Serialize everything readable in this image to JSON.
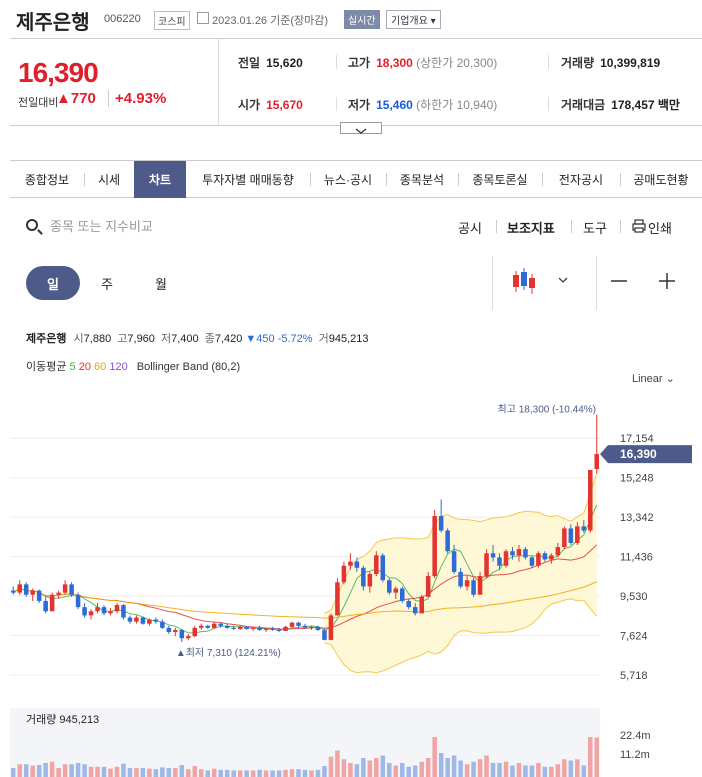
{
  "header": {
    "name": "제주은행",
    "code": "006220",
    "market": "코스피",
    "date": "2023.01.26 기준(장마감)",
    "realtime": "실시간",
    "corp_overview": "기업개요 ▾"
  },
  "price": {
    "current": "16,390",
    "prev_label": "전일대비",
    "change": "▲770",
    "change_pct": "+4.93%",
    "prev_close_label": "전일",
    "prev_close": "15,620",
    "open_label": "시가",
    "open": "15,670",
    "high_label": "고가",
    "high": "18,300",
    "upper_limit": "(상한가 20,300)",
    "low_label": "저가",
    "low": "15,460",
    "lower_limit": "(하한가 10,940)",
    "volume_label": "거래량",
    "volume": "10,399,819",
    "value_label": "거래대금",
    "value": "178,457 백만"
  },
  "tabs": [
    "종합정보",
    "시세",
    "차트",
    "투자자별 매매동향",
    "뉴스·공시",
    "종목분석",
    "종목토론실",
    "전자공시",
    "공매도현황"
  ],
  "active_tab": "차트",
  "search": {
    "placeholder": "종목 또는 지수비교"
  },
  "toolbar": {
    "disclosure": "공시",
    "indicators": "보조지표",
    "tools": "도구",
    "print": "인쇄"
  },
  "periods": [
    "일",
    "주",
    "월"
  ],
  "chart_header": {
    "name": "제주은행",
    "open_l": "시",
    "open": "7,880",
    "high_l": "고",
    "high": "7,960",
    "low_l": "저",
    "low": "7,400",
    "close_l": "종",
    "close": "7,420",
    "change": "▼450 -5.72%",
    "vol_l": "거",
    "vol": "945,213"
  },
  "ma_line": {
    "label": "이동평균",
    "p5": "5",
    "p20": "20",
    "p60": "60",
    "p120": "120",
    "bb": "Bollinger Band (80,2)"
  },
  "scale": "Linear",
  "colors": {
    "up": "#e3342f",
    "down": "#2e6bd6",
    "accent": "#4e5b8a"
  },
  "chart_data": {
    "type": "candlestick",
    "y_ticks": [
      "17,154",
      "15,248",
      "13,342",
      "11,436",
      "9,530",
      "7,624",
      "5,718"
    ],
    "ylim": [
      5000,
      19000
    ],
    "current_label": "16,390",
    "max_label": "최고 18,300 (-10.44%)",
    "min_label": "▲최저 7,310 (124.21%)",
    "candles": [
      [
        9800,
        10000,
        9600,
        9700
      ],
      [
        9700,
        10300,
        9600,
        10100
      ],
      [
        10100,
        10200,
        9500,
        9600
      ],
      [
        9600,
        9900,
        9300,
        9800
      ],
      [
        9800,
        9850,
        9200,
        9300
      ],
      [
        9300,
        9500,
        8700,
        8800
      ],
      [
        8800,
        9700,
        8800,
        9600
      ],
      [
        9600,
        9800,
        9400,
        9700
      ],
      [
        9700,
        10300,
        9600,
        10100
      ],
      [
        10100,
        10200,
        9500,
        9600
      ],
      [
        9600,
        9700,
        8900,
        9000
      ],
      [
        9000,
        9200,
        8500,
        8600
      ],
      [
        8600,
        8900,
        8400,
        8800
      ],
      [
        8800,
        9200,
        8700,
        9000
      ],
      [
        9000,
        9100,
        8600,
        8700
      ],
      [
        8700,
        8950,
        8600,
        8800
      ],
      [
        8800,
        9200,
        8700,
        9100
      ],
      [
        9100,
        9150,
        8400,
        8500
      ],
      [
        8500,
        8600,
        8200,
        8300
      ],
      [
        8300,
        8600,
        8200,
        8500
      ],
      [
        8500,
        8550,
        8150,
        8200
      ],
      [
        8200,
        8450,
        8100,
        8400
      ],
      [
        8400,
        8500,
        8200,
        8300
      ],
      [
        8300,
        8400,
        7950,
        8000
      ],
      [
        8000,
        8100,
        7700,
        7800
      ],
      [
        7800,
        8000,
        7600,
        7900
      ],
      [
        7900,
        7950,
        7310,
        7500
      ],
      [
        7500,
        7700,
        7400,
        7600
      ],
      [
        7600,
        8100,
        7550,
        8000
      ],
      [
        8000,
        8200,
        7900,
        8100
      ],
      [
        8100,
        8150,
        7950,
        8000
      ],
      [
        8000,
        8300,
        7950,
        8200
      ],
      [
        8200,
        8250,
        8000,
        8100
      ],
      [
        8100,
        8200,
        7950,
        8000
      ],
      [
        8000,
        8100,
        7900,
        7950
      ],
      [
        7950,
        8100,
        7900,
        8050
      ],
      [
        8050,
        8100,
        7900,
        7950
      ],
      [
        7950,
        8050,
        7850,
        8000
      ],
      [
        8000,
        8100,
        7850,
        7900
      ],
      [
        7900,
        8000,
        7800,
        7950
      ],
      [
        7950,
        8050,
        7850,
        7900
      ],
      [
        7900,
        8000,
        7800,
        7850
      ],
      [
        7850,
        8100,
        7850,
        8050
      ],
      [
        8050,
        8300,
        8000,
        8250
      ],
      [
        8250,
        8300,
        8000,
        8100
      ],
      [
        8100,
        8200,
        7950,
        8000
      ],
      [
        8000,
        8100,
        7900,
        8050
      ],
      [
        8050,
        8100,
        7850,
        7900
      ],
      [
        7880,
        7960,
        7400,
        7420
      ],
      [
        7420,
        8700,
        7400,
        8600
      ],
      [
        8600,
        10400,
        8600,
        10200
      ],
      [
        10200,
        11200,
        10100,
        11000
      ],
      [
        11000,
        11600,
        10800,
        11200
      ],
      [
        11200,
        11400,
        10700,
        10900
      ],
      [
        10900,
        11000,
        9800,
        10000
      ],
      [
        10000,
        10700,
        9700,
        10600
      ],
      [
        10600,
        11700,
        10500,
        11500
      ],
      [
        11500,
        11600,
        10200,
        10300
      ],
      [
        10300,
        10400,
        9600,
        9700
      ],
      [
        9700,
        10000,
        9400,
        9900
      ],
      [
        9900,
        10000,
        9200,
        9300
      ],
      [
        9300,
        9400,
        8900,
        9000
      ],
      [
        9000,
        9200,
        8600,
        8700
      ],
      [
        8700,
        9600,
        8700,
        9500
      ],
      [
        9500,
        10700,
        9500,
        10500
      ],
      [
        10500,
        13700,
        10400,
        13400
      ],
      [
        13400,
        14200,
        12600,
        12700
      ],
      [
        12700,
        12800,
        11600,
        11700
      ],
      [
        11700,
        12000,
        10600,
        10700
      ],
      [
        10700,
        10900,
        9900,
        10000
      ],
      [
        10000,
        10500,
        9800,
        10300
      ],
      [
        10300,
        10400,
        9500,
        9600
      ],
      [
        9600,
        10700,
        9600,
        10500
      ],
      [
        10500,
        11800,
        10400,
        11600
      ],
      [
        11600,
        12000,
        11200,
        11400
      ],
      [
        11400,
        11600,
        10800,
        11000
      ],
      [
        11000,
        11800,
        10900,
        11700
      ],
      [
        11700,
        11900,
        11300,
        11500
      ],
      [
        11500,
        12000,
        11200,
        11800
      ],
      [
        11800,
        11900,
        11300,
        11400
      ],
      [
        11400,
        11500,
        10900,
        11000
      ],
      [
        11000,
        11700,
        10900,
        11600
      ],
      [
        11600,
        11700,
        11200,
        11300
      ],
      [
        11300,
        11600,
        11100,
        11500
      ],
      [
        11500,
        12100,
        11400,
        11900
      ],
      [
        11900,
        12900,
        11800,
        12800
      ],
      [
        12800,
        13000,
        12000,
        12100
      ],
      [
        12100,
        13100,
        12000,
        12900
      ],
      [
        12900,
        13200,
        12600,
        12700
      ],
      [
        12700,
        15600,
        12600,
        15620
      ],
      [
        15670,
        18300,
        15460,
        16390
      ]
    ],
    "volume_label": "거래량 945,213",
    "volume_ticks": [
      "22.4m",
      "11.2m"
    ]
  }
}
